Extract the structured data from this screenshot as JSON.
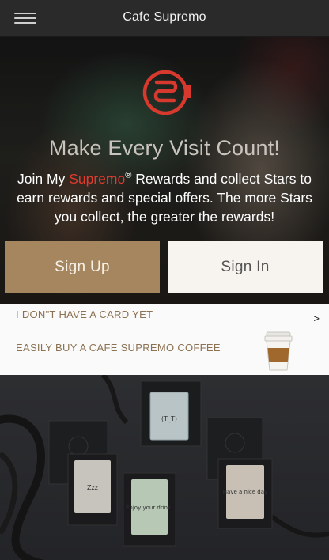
{
  "app": {
    "title": "Cafe Supremo",
    "menu_icon": "hamburger-menu-icon"
  },
  "hero": {
    "logo": "cafe-supremo-logo",
    "headline": "Make Every Visit Count!",
    "sub_prefix": "Join My ",
    "brand": "Supremo",
    "reg": "®",
    "sub_suffix": " Rewards and collect Stars to earn rewards and special offers. The more Stars you collect, the greater the rewards!",
    "colors": {
      "brand": "#e23b2e",
      "signup_bg": "#a6865f",
      "signin_bg": "#f7f4ef"
    }
  },
  "buttons": {
    "signup": "Sign Up",
    "signin": "Sign In"
  },
  "card_prompt": {
    "line1": "I DON\"T HAVE A CARD YET",
    "chevron": ">",
    "line2": "EASILY BUY A CAFE SUPREMO COFFEE",
    "icon": "coffee-cup-icon"
  },
  "gift_cards": {
    "card1_text": "(T_T)",
    "card2_text": "Zzz",
    "card3_text": "Enjoy your drink!",
    "card4_text": "Have a nice day"
  }
}
